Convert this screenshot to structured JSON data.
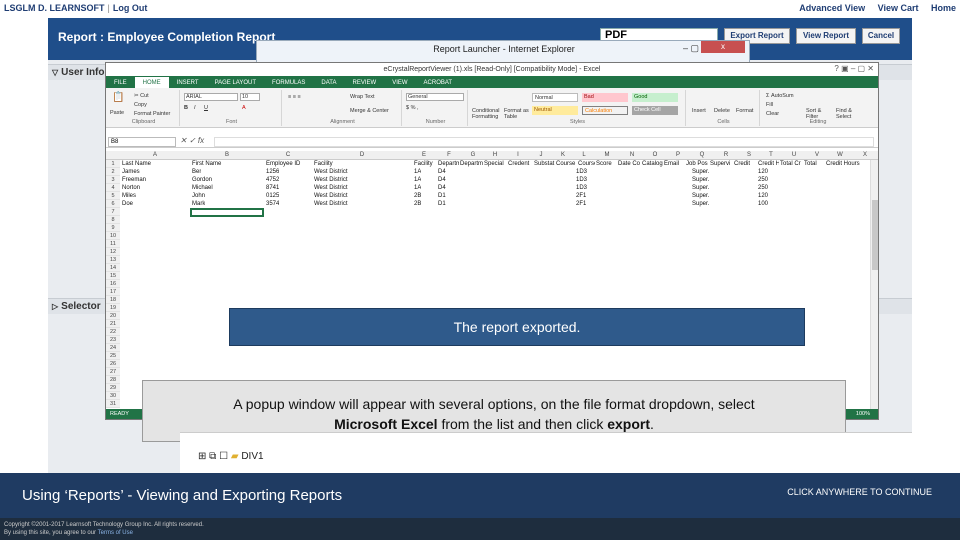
{
  "topbar": {
    "brand": "LSGLM",
    "brand_org": "D. LEARNSOFT",
    "logout": "Log Out",
    "links": [
      "Advanced View",
      "View Cart",
      "Home"
    ]
  },
  "report": {
    "title": "Report : Employee Completion Report",
    "format_value": "PDF",
    "buttons": [
      "Export Report",
      "View Report",
      "Cancel"
    ]
  },
  "sections": {
    "user_info": "User Info",
    "selector": "Selector"
  },
  "ie_window": {
    "title": "Report Launcher - Internet Explorer",
    "close": "x"
  },
  "excel": {
    "title": "eCrystalReportViewer (1).xls [Read-Only] [Compatibility Mode] - Excel",
    "tabs": [
      "FILE",
      "HOME",
      "INSERT",
      "PAGE LAYOUT",
      "FORMULAS",
      "DATA",
      "REVIEW",
      "VIEW",
      "ACROBAT"
    ],
    "ribbon": {
      "clipboard": {
        "label": "Clipboard",
        "paste": "Paste",
        "cut": "Cut",
        "copy": "Copy",
        "format_painter": "Format Painter"
      },
      "font": {
        "label": "Font",
        "name": "ARIAL",
        "size": "10"
      },
      "alignment": {
        "label": "Alignment",
        "wrap": "Wrap Text",
        "merge": "Merge & Center"
      },
      "number": {
        "label": "Number",
        "format": "General"
      },
      "styles": {
        "label": "Styles",
        "conditional": "Conditional Formatting",
        "format_table": "Format as Table",
        "cells": [
          {
            "name": "Normal",
            "color": "#ffffff"
          },
          {
            "name": "Bad",
            "color": "#ffc7ce"
          },
          {
            "name": "Good",
            "color": "#c6efce"
          },
          {
            "name": "Neutral",
            "color": "#ffeb9c"
          },
          {
            "name": "Calculation",
            "color": "#f2f2f2"
          },
          {
            "name": "Check Cell",
            "color": "#a5a5a5"
          }
        ]
      },
      "cells_group": {
        "label": "Cells",
        "insert": "Insert",
        "delete": "Delete",
        "format": "Format"
      },
      "editing": {
        "label": "Editing",
        "autosum": "AutoSum",
        "fill": "Fill",
        "clear": "Clear",
        "sort": "Sort & Filter",
        "find": "Find & Select"
      }
    },
    "name_box": "B8",
    "fx": "fx",
    "columns": [
      "A",
      "B",
      "C",
      "D",
      "E",
      "F",
      "G",
      "H",
      "I",
      "J",
      "K",
      "L",
      "M",
      "N",
      "O",
      "P",
      "Q",
      "R",
      "S",
      "T",
      "U",
      "V",
      "W",
      "X"
    ],
    "headers": [
      "Last Name",
      "First Name",
      "Employee ID",
      "Facility",
      "Facility",
      "Departm",
      "Departm",
      "Special",
      "Credent",
      "Substat",
      "Course",
      "Course",
      "Score",
      "Date Co",
      "Catalog",
      "Email",
      "Job Pos",
      "Supervi",
      "Credit",
      "Credit H",
      "Total Cr",
      "Total",
      "Credit Hours"
    ],
    "rows": [
      [
        "James",
        "Ber",
        "1256",
        "West District",
        "1A",
        "D4",
        "1D3",
        "Super.",
        "120"
      ],
      [
        "Freeman",
        "Gordon",
        "4752",
        "West District",
        "1A",
        "D4",
        "1D3",
        "Super.",
        "250"
      ],
      [
        "Norton",
        "Michael",
        "8741",
        "West District",
        "1A",
        "D4",
        "1D3",
        "Super.",
        "250"
      ],
      [
        "Miles",
        "John",
        "0125",
        "West District",
        "2B",
        "D1",
        "2F1",
        "Super.",
        "120"
      ],
      [
        "Doe",
        "Mark",
        "3574",
        "West District",
        "2B",
        "D1",
        "2F1",
        "Super.",
        "100"
      ]
    ],
    "row_numbers": [
      "1",
      "2",
      "3",
      "4",
      "5",
      "6",
      "7",
      "8",
      "9",
      "10",
      "11",
      "12",
      "13",
      "14",
      "15",
      "16",
      "17",
      "18",
      "19",
      "20",
      "21",
      "22",
      "23",
      "24",
      "25",
      "26",
      "27",
      "28",
      "29",
      "30",
      "31"
    ],
    "status": "READY",
    "zoom": "100%"
  },
  "callouts": {
    "exported": "The report exported.",
    "instruction_pre": "A popup window will appear with several options, on the file format dropdown, select",
    "instruction_bold1": "Microsoft Excel",
    "instruction_mid": "from the list and then click",
    "instruction_bold2": "export",
    "instruction_end": "."
  },
  "tree": {
    "item": "DIV1"
  },
  "footer": {
    "title": "Using ‘Reports’ - Viewing and Exporting Reports",
    "continue": "CLICK ANYWHERE TO CONTINUE"
  },
  "copyright": {
    "line1": "Copyright ©2001-2017 Learnsoft Technology Group Inc. All rights reserved.",
    "line2": "By using this site, you agree to our",
    "terms": "Terms of Use"
  }
}
